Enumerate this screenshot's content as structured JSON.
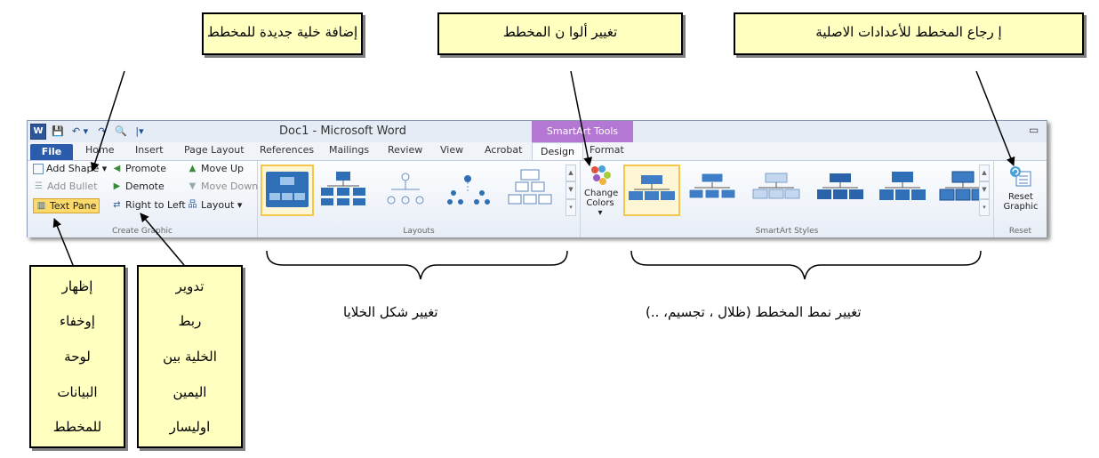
{
  "callouts": {
    "add_cell": "إضافة خلية جديدة للمخطط",
    "change_colors": "تغيير ألوا ن المخطط",
    "reset": "إ رجاع المخطط للأعدادات الاصلية",
    "toggle_text_pane": [
      "إظهار",
      "إوخفاء",
      "لوحة",
      "البيانات",
      "للمخطط"
    ],
    "rtl": [
      "تدوير",
      "ربط",
      "الخلية بين",
      "اليمين",
      "اوليسار"
    ]
  },
  "captions": {
    "layouts": "تغيير شكل الخلايا",
    "styles": "تغيير نمط المخطط (ظلال ، تجسيم، ..)"
  },
  "window": {
    "title": "Doc1 - Microsoft Word",
    "contextual_group": "SmartArt Tools",
    "minimize_glyph": "▭"
  },
  "qat": {
    "word_logo": "W",
    "save": "💾",
    "undo": "↶ ▾",
    "redo": "↷",
    "print_preview": "🔍",
    "customize": "|▾"
  },
  "tabs": [
    "Home",
    "Insert",
    "Page Layout",
    "References",
    "Mailings",
    "Review",
    "View",
    "Acrobat"
  ],
  "file_tab": "File",
  "design_tab": "Design",
  "format_tab": "Format",
  "ribbon": {
    "create_graphic": {
      "label": "Create Graphic",
      "add_shape": "Add Shape ▾",
      "add_bullet": "Add Bullet",
      "text_pane": "Text Pane",
      "promote": "Promote",
      "demote": "Demote",
      "right_to_left": "Right to Left",
      "move_up": "Move Up",
      "move_down": "Move Down",
      "layout": "Layout ▾"
    },
    "layouts": {
      "label": "Layouts"
    },
    "smartart_styles": {
      "label": "SmartArt Styles",
      "change_colors": [
        "Change",
        "Colors ▾"
      ]
    },
    "reset": {
      "label": "Reset",
      "reset_graphic": [
        "Reset",
        "Graphic"
      ]
    }
  },
  "colors": {
    "callout_bg": "#ffffbf",
    "smartart_tools": "#b477d3",
    "file_tab": "#2a5cab",
    "shape_blue": "#2f6fb7"
  }
}
